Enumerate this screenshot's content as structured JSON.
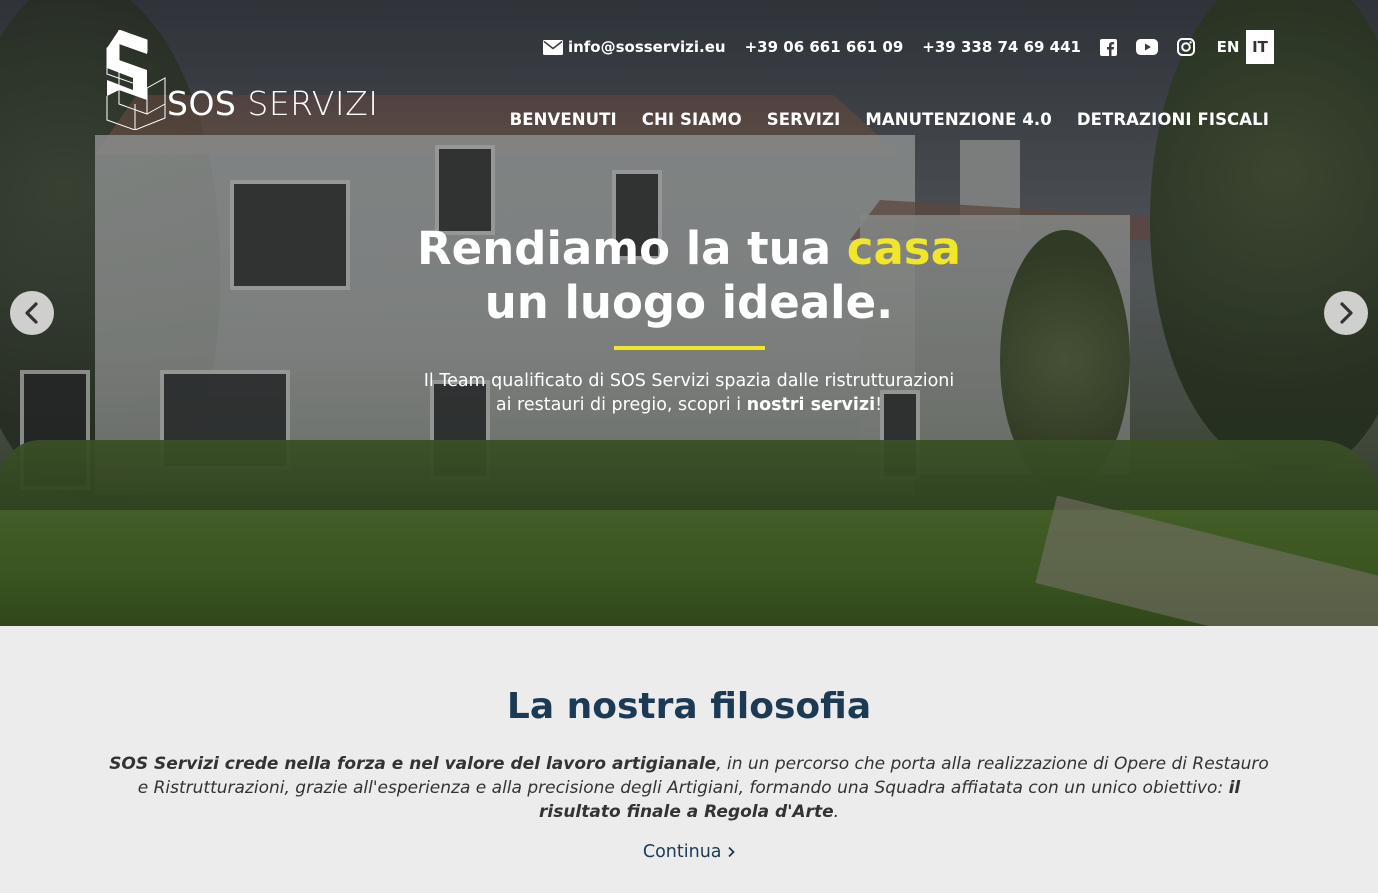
{
  "brand": {
    "name_bold": "SOS",
    "name_light": "SERVIZI"
  },
  "topbar": {
    "email": "info@sosservizi.eu",
    "phone1": "+39 06 661 661 09",
    "phone2": "+39 338 74 69 441",
    "languages": [
      "EN",
      "IT"
    ],
    "active_language": "IT"
  },
  "nav": {
    "items": [
      "BENVENUTI",
      "CHI SIAMO",
      "SERVIZI",
      "MANUTENZIONE 4.0",
      "DETRAZIONI FISCALI"
    ]
  },
  "hero": {
    "headline_part1": "Rendiamo la tua ",
    "headline_highlight": "casa",
    "headline_line2": "un luogo ideale.",
    "subtitle_line1": "Il Team qualificato di SOS Servizi spazia dalle ristrutturazioni",
    "subtitle_line2_prefix": "ai restauri di pregio, scopri i ",
    "subtitle_line2_bold": "nostri servizi",
    "subtitle_line2_suffix": "!",
    "highlight_color": "#f0e62a"
  },
  "philosophy": {
    "title": "La nostra filosofia",
    "text_bold1": "SOS Servizi crede nella forza e nel valore del lavoro artigianale",
    "text_mid": ", in un percorso che porta alla realizzazione di Opere di Restauro e Ristrutturazioni, grazie all'esperienza e alla precisione degli Artigiani, formando una Squadra affiatata con un unico obiettivo: ",
    "text_bold2": "il risultato finale a Regola d'Arte",
    "text_end": ".",
    "link_label": "Continua"
  },
  "icons": [
    "envelope-icon",
    "facebook-icon",
    "youtube-icon",
    "instagram-icon",
    "chevron-left-icon",
    "chevron-right-icon"
  ],
  "colors": {
    "title_blue": "#1d3a55",
    "accent_yellow": "#f0e62a",
    "section_bg": "#ececec"
  }
}
